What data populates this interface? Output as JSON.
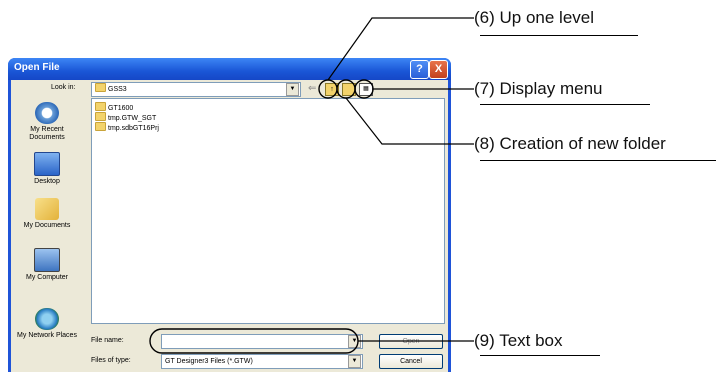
{
  "dialog": {
    "title": "Open File",
    "help_symbol": "?",
    "close_symbol": "X",
    "look_in_label": "Look in:",
    "look_in_value": "GSS3",
    "places": [
      {
        "label": "My Recent Documents",
        "icon": "recent-documents-icon"
      },
      {
        "label": "Desktop",
        "icon": "desktop-icon"
      },
      {
        "label": "My Documents",
        "icon": "my-documents-icon"
      },
      {
        "label": "My Computer",
        "icon": "my-computer-icon"
      },
      {
        "label": "My Network Places",
        "icon": "network-places-icon"
      }
    ],
    "files": [
      "GT1600",
      "tmp.GTW_SGT",
      "tmp.sdbGT16Prj"
    ],
    "file_name_label": "File name:",
    "file_name_value": "",
    "files_of_type_label": "Files of type:",
    "files_of_type_value": "GT Designer3 Files (*.GTW)",
    "open_button": "Open",
    "cancel_button": "Cancel"
  },
  "annotations": {
    "up_one_level": "(6) Up one level",
    "display_menu": "(7) Display menu",
    "new_folder": "(8) Creation of new folder",
    "text_box": "(9) Text box"
  },
  "colors": {
    "titlebar": "#1f54d8",
    "dialog_bg": "#ece9d8",
    "close": "#c2401e"
  }
}
